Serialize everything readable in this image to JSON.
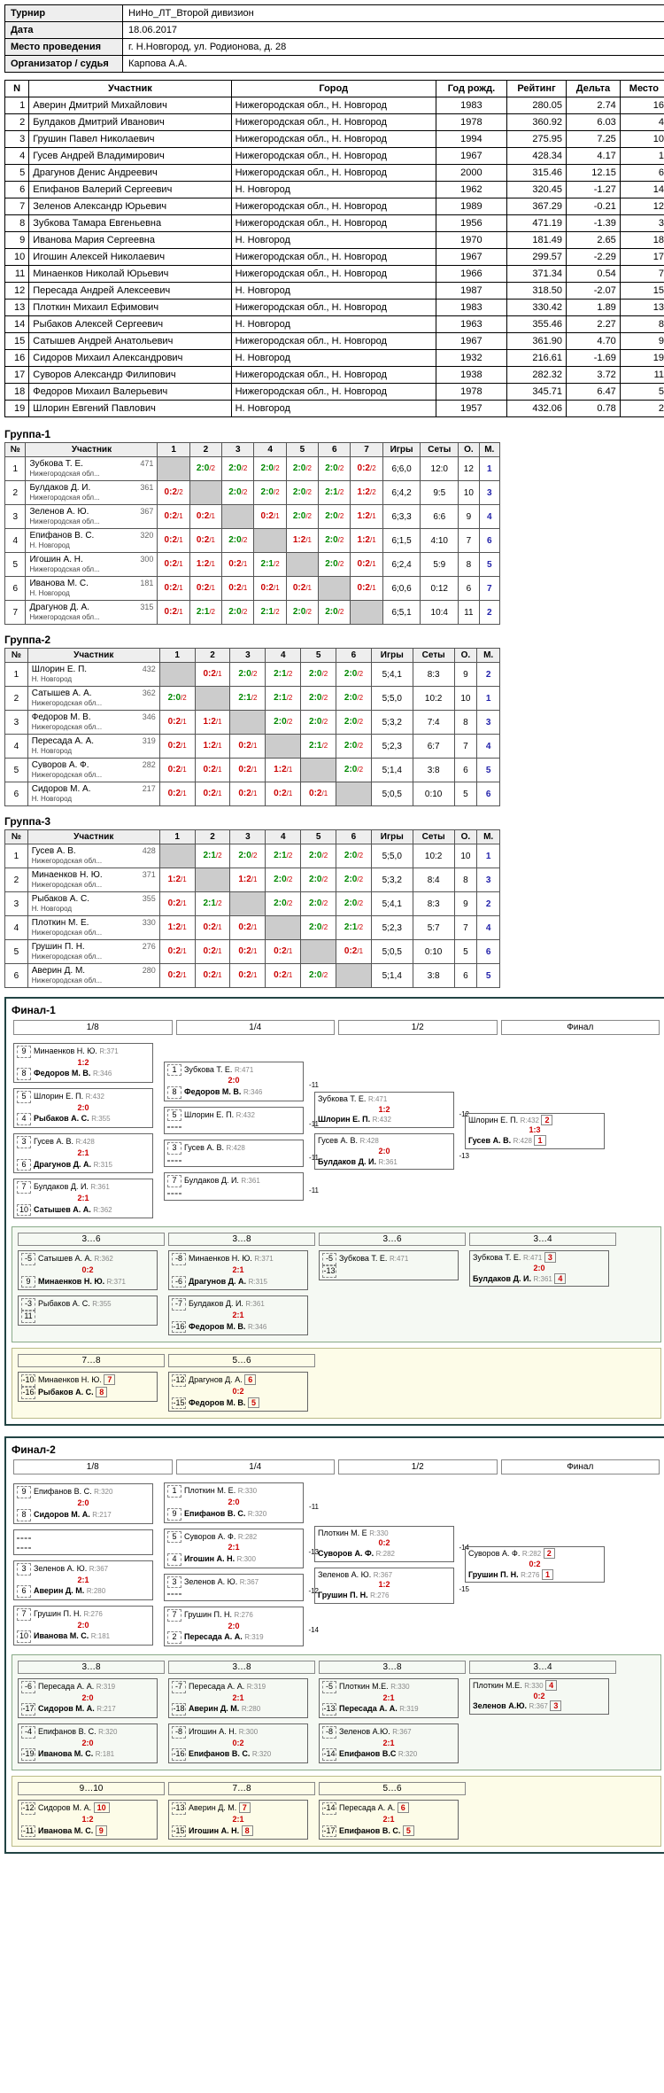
{
  "info": {
    "tournament_lbl": "Турнир",
    "tournament": "НиНо_ЛТ_Второй дивизион",
    "date_lbl": "Дата",
    "date": "18.06.2017",
    "venue_lbl": "Место проведения",
    "venue": "г. Н.Новгород, ул. Родионова, д. 28",
    "org_lbl": "Организатор / судья",
    "org": "Карпова А.А."
  },
  "headers": {
    "n": "N",
    "participant": "Участник",
    "city": "Город",
    "year": "Год рожд.",
    "rating": "Рейтинг",
    "delta": "Дельта",
    "place": "Место"
  },
  "players": [
    {
      "n": 1,
      "name": "Аверин Дмитрий Михайлович",
      "city": "Нижегородская обл., Н. Новгород",
      "year": 1983,
      "rating": "280.05",
      "delta": "2.74",
      "place": 16
    },
    {
      "n": 2,
      "name": "Булдаков Дмитрий Иванович",
      "city": "Нижегородская обл., Н. Новгород",
      "year": 1978,
      "rating": "360.92",
      "delta": "6.03",
      "place": 4
    },
    {
      "n": 3,
      "name": "Грушин Павел Николаевич",
      "city": "Нижегородская обл., Н. Новгород",
      "year": 1994,
      "rating": "275.95",
      "delta": "7.25",
      "place": 10
    },
    {
      "n": 4,
      "name": "Гусев Андрей Владимирович",
      "city": "Нижегородская обл., Н. Новгород",
      "year": 1967,
      "rating": "428.34",
      "delta": "4.17",
      "place": 1
    },
    {
      "n": 5,
      "name": "Драгунов Денис Андреевич",
      "city": "Нижегородская обл., Н. Новгород",
      "year": 2000,
      "rating": "315.46",
      "delta": "12.15",
      "place": 6
    },
    {
      "n": 6,
      "name": "Епифанов Валерий Сергеевич",
      "city": "Н. Новгород",
      "year": 1962,
      "rating": "320.45",
      "delta": "-1.27",
      "place": 14
    },
    {
      "n": 7,
      "name": "Зеленов Александр Юрьевич",
      "city": "Нижегородская обл., Н. Новгород",
      "year": 1989,
      "rating": "367.29",
      "delta": "-0.21",
      "place": 12
    },
    {
      "n": 8,
      "name": "Зубкова Тамара Евгеньевна",
      "city": "Нижегородская обл., Н. Новгород",
      "year": 1956,
      "rating": "471.19",
      "delta": "-1.39",
      "place": 3
    },
    {
      "n": 9,
      "name": "Иванова Мария Сергеевна",
      "city": "Н. Новгород",
      "year": 1970,
      "rating": "181.49",
      "delta": "2.65",
      "place": 18
    },
    {
      "n": 10,
      "name": "Игошин Алексей Николаевич",
      "city": "Нижегородская обл., Н. Новгород",
      "year": 1967,
      "rating": "299.57",
      "delta": "-2.29",
      "place": 17
    },
    {
      "n": 11,
      "name": "Минаенков Николай Юрьевич",
      "city": "Нижегородская обл., Н. Новгород",
      "year": 1966,
      "rating": "371.34",
      "delta": "0.54",
      "place": 7
    },
    {
      "n": 12,
      "name": "Пересада Андрей Алексеевич",
      "city": "Н. Новгород",
      "year": 1987,
      "rating": "318.50",
      "delta": "-2.07",
      "place": 15
    },
    {
      "n": 13,
      "name": "Плоткин Михаил Ефимович",
      "city": "Нижегородская обл., Н. Новгород",
      "year": 1983,
      "rating": "330.42",
      "delta": "1.89",
      "place": 13
    },
    {
      "n": 14,
      "name": "Рыбаков Алексей Сергеевич",
      "city": "Н. Новгород",
      "year": 1963,
      "rating": "355.46",
      "delta": "2.27",
      "place": 8
    },
    {
      "n": 15,
      "name": "Сатышев Андрей Анатольевич",
      "city": "Нижегородская обл., Н. Новгород",
      "year": 1967,
      "rating": "361.90",
      "delta": "4.70",
      "place": 9
    },
    {
      "n": 16,
      "name": "Сидоров Михаил Александрович",
      "city": "Н. Новгород",
      "year": 1932,
      "rating": "216.61",
      "delta": "-1.69",
      "place": 19
    },
    {
      "n": 17,
      "name": "Суворов Александр Филипович",
      "city": "Нижегородская обл., Н. Новгород",
      "year": 1938,
      "rating": "282.32",
      "delta": "3.72",
      "place": 11
    },
    {
      "n": 18,
      "name": "Федоров Михаил Валерьевич",
      "city": "Нижегородская обл., Н. Новгород",
      "year": 1978,
      "rating": "345.71",
      "delta": "6.47",
      "place": 5
    },
    {
      "n": 19,
      "name": "Шлорин Евгений Павлович",
      "city": "Н. Новгород",
      "year": 1957,
      "rating": "432.06",
      "delta": "0.78",
      "place": 2
    }
  ],
  "group_labels": {
    "g1": "Группа-1",
    "g2": "Группа-2",
    "g3": "Группа-3"
  },
  "group_headers": {
    "num": "№",
    "participant": "Участник",
    "games": "Игры",
    "sets": "Сеты",
    "o": "О.",
    "m": "М."
  },
  "group1": {
    "players": [
      {
        "n": 1,
        "nm": "Зубкова Т. Е.",
        "ct": "Нижегородская обл...",
        "rt": "471"
      },
      {
        "n": 2,
        "nm": "Булдаков Д. И.",
        "ct": "Нижегородская обл...",
        "rt": "361"
      },
      {
        "n": 3,
        "nm": "Зеленов А. Ю.",
        "ct": "Нижегородская обл...",
        "rt": "367"
      },
      {
        "n": 4,
        "nm": "Епифанов В. С.",
        "ct": "Н. Новгород",
        "rt": "320"
      },
      {
        "n": 5,
        "nm": "Игошин А. Н.",
        "ct": "Нижегородская обл...",
        "rt": "300"
      },
      {
        "n": 6,
        "nm": "Иванова М. С.",
        "ct": "Н. Новгород",
        "rt": "181"
      },
      {
        "n": 7,
        "nm": "Драгунов Д. А.",
        "ct": "Нижегородская обл...",
        "rt": "315"
      }
    ],
    "cells": [
      [
        "",
        "2:0/2",
        "2:0/2",
        "2:0/2",
        "2:0/2",
        "2:0/2",
        "0:2/2",
        "6;6,0",
        "12:0",
        "12",
        "1"
      ],
      [
        "0:2/2",
        "",
        "2:0/2",
        "2:0/2",
        "2:0/2",
        "2:1/2",
        "1:2/2",
        "6;4,2",
        "9:5",
        "10",
        "3"
      ],
      [
        "0:2/1",
        "0:2/1",
        "",
        "0:2/1",
        "2:0/2",
        "2:0/2",
        "1:2/1",
        "6;3,3",
        "6:6",
        "9",
        "4"
      ],
      [
        "0:2/1",
        "0:2/1",
        "2:0/2",
        "",
        "1:2/1",
        "2:0/2",
        "1:2/1",
        "6;1,5",
        "4:10",
        "7",
        "6"
      ],
      [
        "0:2/1",
        "1:2/1",
        "0:2/1",
        "2:1/2",
        "",
        "2:0/2",
        "0:2/1",
        "6;2,4",
        "5:9",
        "8",
        "5"
      ],
      [
        "0:2/1",
        "0:2/1",
        "0:2/1",
        "0:2/1",
        "0:2/1",
        "",
        "0:2/1",
        "6;0,6",
        "0:12",
        "6",
        "7"
      ],
      [
        "0:2/1",
        "2:1/2",
        "2:0/2",
        "2:1/2",
        "2:0/2",
        "2:0/2",
        "",
        "6;5,1",
        "10:4",
        "11",
        "2"
      ]
    ]
  },
  "group2": {
    "players": [
      {
        "n": 1,
        "nm": "Шлорин Е. П.",
        "ct": "Н. Новгород",
        "rt": "432"
      },
      {
        "n": 2,
        "nm": "Сатышев А. А.",
        "ct": "Нижегородская обл...",
        "rt": "362"
      },
      {
        "n": 3,
        "nm": "Федоров М. В.",
        "ct": "Нижегородская обл...",
        "rt": "346"
      },
      {
        "n": 4,
        "nm": "Пересада А. А.",
        "ct": "Н. Новгород",
        "rt": "319"
      },
      {
        "n": 5,
        "nm": "Суворов А. Ф.",
        "ct": "Нижегородская обл...",
        "rt": "282"
      },
      {
        "n": 6,
        "nm": "Сидоров М. А.",
        "ct": "Н. Новгород",
        "rt": "217"
      }
    ],
    "cells": [
      [
        "",
        "0:2/1",
        "2:0/2",
        "2:1/2",
        "2:0/2",
        "2:0/2",
        "5;4,1",
        "8:3",
        "9",
        "2"
      ],
      [
        "2:0/2",
        "",
        "2:1/2",
        "2:1/2",
        "2:0/2",
        "2:0/2",
        "5;5,0",
        "10:2",
        "10",
        "1"
      ],
      [
        "0:2/1",
        "1:2/1",
        "",
        "2:0/2",
        "2:0/2",
        "2:0/2",
        "5;3,2",
        "7:4",
        "8",
        "3"
      ],
      [
        "0:2/1",
        "1:2/1",
        "0:2/1",
        "",
        "2:1/2",
        "2:0/2",
        "5;2,3",
        "6:7",
        "7",
        "4"
      ],
      [
        "0:2/1",
        "0:2/1",
        "0:2/1",
        "1:2/1",
        "",
        "2:0/2",
        "5;1,4",
        "3:8",
        "6",
        "5"
      ],
      [
        "0:2/1",
        "0:2/1",
        "0:2/1",
        "0:2/1",
        "0:2/1",
        "",
        "5;0,5",
        "0:10",
        "5",
        "6"
      ]
    ]
  },
  "group3": {
    "players": [
      {
        "n": 1,
        "nm": "Гусев А. В.",
        "ct": "Нижегородская обл...",
        "rt": "428"
      },
      {
        "n": 2,
        "nm": "Минаенков Н. Ю.",
        "ct": "Нижегородская обл...",
        "rt": "371"
      },
      {
        "n": 3,
        "nm": "Рыбаков А. С.",
        "ct": "Н. Новгород",
        "rt": "355"
      },
      {
        "n": 4,
        "nm": "Плоткин М. Е.",
        "ct": "Нижегородская обл...",
        "rt": "330"
      },
      {
        "n": 5,
        "nm": "Грушин П. Н.",
        "ct": "Нижегородская обл...",
        "rt": "276"
      },
      {
        "n": 6,
        "nm": "Аверин Д. М.",
        "ct": "Нижегородская обл...",
        "rt": "280"
      }
    ],
    "cells": [
      [
        "",
        "2:1/2",
        "2:0/2",
        "2:1/2",
        "2:0/2",
        "2:0/2",
        "5;5,0",
        "10:2",
        "10",
        "1"
      ],
      [
        "1:2/1",
        "",
        "1:2/1",
        "2:0/2",
        "2:0/2",
        "2:0/2",
        "5;3,2",
        "8:4",
        "8",
        "3"
      ],
      [
        "0:2/1",
        "2:1/2",
        "",
        "2:0/2",
        "2:0/2",
        "2:0/2",
        "5;4,1",
        "8:3",
        "9",
        "2"
      ],
      [
        "1:2/1",
        "0:2/1",
        "0:2/1",
        "",
        "2:0/2",
        "2:1/2",
        "5;2,3",
        "5:7",
        "7",
        "4"
      ],
      [
        "0:2/1",
        "0:2/1",
        "0:2/1",
        "0:2/1",
        "",
        "0:2/1",
        "5;0,5",
        "0:10",
        "5",
        "6"
      ],
      [
        "0:2/1",
        "0:2/1",
        "0:2/1",
        "0:2/1",
        "2:0/2",
        "",
        "5;1,4",
        "3:8",
        "6",
        "5"
      ]
    ]
  },
  "brackets": {
    "f1": {
      "title": "Финал-1",
      "rounds": [
        "1/8",
        "1/4",
        "1/2",
        "Финал"
      ],
      "r18": [
        {
          "s1": "9",
          "p1": "Минаенков Н. Ю.",
          "r1": "R:371",
          "sc": "1:2",
          "s2": "8",
          "p2": "Федоров М. В.",
          "r2": "R:346"
        },
        {
          "s1": "5",
          "p1": "Шлорин Е. П.",
          "r1": "R:432",
          "sc": "2:0",
          "s2": "4",
          "p2": "Рыбаков А. С.",
          "r2": "R:355"
        },
        {
          "s1": "3",
          "p1": "Гусев А. В.",
          "r1": "R:428",
          "sc": "2:1",
          "s2": "6",
          "p2": "Драгунов Д. А.",
          "r2": "R:315"
        },
        {
          "s1": "7",
          "p1": "Булдаков Д. И.",
          "r1": "R:361",
          "sc": "2:1",
          "s2": "10",
          "p2": "Сатышев А. А.",
          "r2": "R:362"
        }
      ],
      "r14": [
        {
          "s1": "1",
          "p1": "Зубкова Т. Е.",
          "r1": "R:471",
          "sc": "2:0",
          "s2": "8",
          "p2": "Федоров М. В.",
          "r2": "R:346",
          "pt": "-11"
        },
        {
          "s1": "5",
          "p1": "Шлорин Е. П.",
          "r1": "R:432",
          "sc": "",
          "s2": "",
          "p2": "",
          "r2": "",
          "pt": "-11"
        },
        {
          "s1": "3",
          "p1": "Гусев А. В.",
          "r1": "R:428",
          "sc": "",
          "s2": "",
          "p2": "",
          "r2": "",
          "pt": "-11"
        },
        {
          "s1": "7",
          "p1": "Булдаков Д. И.",
          "r1": "R:361",
          "sc": "",
          "s2": "",
          "p2": "",
          "r2": "",
          "pt": "-11"
        }
      ],
      "r12": [
        {
          "p1": "Зубкова Т. Е.",
          "r1": "R:471",
          "sc": "1:2",
          "p2": "Шлорин Е. П.",
          "r2": "R:432",
          "pt": "-12"
        },
        {
          "p1": "Гусев А. В.",
          "r1": "R:428",
          "sc": "2:0",
          "p2": "Булдаков Д. И.",
          "r2": "R:361",
          "pt": "-13"
        }
      ],
      "final": {
        "p1": "Шлорин Е. П.",
        "r1": "R:432",
        "sc": "1:3",
        "p2": "Гусев А. В.",
        "r2": "R:428",
        "pl1": "2",
        "pl2": "1"
      },
      "losers36": {
        "label36": "3…6",
        "label38": "3…8",
        "label34": "3…4",
        "m": [
          {
            "s1": "-5",
            "p1": "Сатышев А. А.",
            "r1": "R:362",
            "sc": "0:2",
            "p2": "Минаенков Н. Ю.",
            "r2": "R:371",
            "s2": "9"
          },
          {
            "s1": "-3",
            "p1": "Рыбаков А. С.",
            "r1": "R:355",
            "sc": "",
            "p2": "",
            "s2": "11"
          },
          {
            "s1": "-8",
            "p1": "Минаенков Н. Ю.",
            "r1": "R:371",
            "sc": "2:1",
            "p2": "Драгунов Д. А.",
            "r2": "R:315",
            "s2": "-6"
          },
          {
            "s1": "-7",
            "p1": "Булдаков Д. И.",
            "r1": "R:361",
            "sc": "2:1",
            "p2": "Федоров М. В.",
            "r2": "R:346",
            "s2": "-16"
          },
          {
            "s1": "-5",
            "p1": "Зубкова Т. Е.",
            "r1": "R:471",
            "sc": "",
            "p2": "",
            "s2": "-13"
          },
          {
            "p1": "Зубкова Т. Е.",
            "r1": "R:471",
            "sc": "2:0",
            "p2": "Булдаков Д. И.",
            "r2": "R:361",
            "pl1": "3",
            "pl2": "4"
          }
        ]
      },
      "losers78": {
        "label78": "7…8",
        "label56": "5…6",
        "m": [
          {
            "s1": "-10",
            "p1": "Минаенков Н. Ю.",
            "sc": "",
            "p2": "Рыбаков А. С.",
            "s2": "-16",
            "pl1": "7",
            "pl2": "8"
          },
          {
            "s1": "-12",
            "p1": "Драгунов Д. А.",
            "sc": "0:2",
            "p2": "Федоров М. В.",
            "s2": "-15",
            "pl1": "6",
            "pl2": "5"
          }
        ]
      }
    },
    "f2": {
      "title": "Финал-2",
      "rounds": [
        "1/8",
        "1/4",
        "1/2",
        "Финал"
      ],
      "r18": [
        {
          "s1": "9",
          "p1": "Епифанов В. С.",
          "r1": "R:320",
          "sc": "2:0",
          "s2": "8",
          "p2": "Сидоров М. А.",
          "r2": "R:217"
        },
        {
          "s1": "",
          "p1": "",
          "sc": "",
          "s2": "",
          "p2": ""
        },
        {
          "s1": "3",
          "p1": "Зеленов А. Ю.",
          "r1": "R:367",
          "sc": "2:1",
          "s2": "6",
          "p2": "Аверин Д. М.",
          "r2": "R:280"
        },
        {
          "s1": "7",
          "p1": "Грушин П. Н.",
          "r1": "R:276",
          "sc": "2:0",
          "s2": "10",
          "p2": "Иванова М. С.",
          "r2": "R:181"
        }
      ],
      "r14": [
        {
          "s1": "1",
          "p1": "Плоткин М. Е.",
          "r1": "R:330",
          "sc": "2:0",
          "s2": "9",
          "p2": "Епифанов В. С.",
          "r2": "R:320",
          "pt": "-11"
        },
        {
          "s1": "5",
          "p1": "Суворов А. Ф.",
          "r1": "R:282",
          "sc": "2:1",
          "s2": "4",
          "p2": "Игошин А. Н.",
          "r2": "R:300",
          "pt": "-13"
        },
        {
          "s1": "3",
          "p1": "Зеленов А. Ю.",
          "r1": "R:367",
          "sc": "",
          "s2": "",
          "p2": "",
          "r2": "",
          "pt": "-12"
        },
        {
          "s1": "7",
          "p1": "Грушин П. Н.",
          "r1": "R:276",
          "sc": "2:0",
          "s2": "2",
          "p2": "Пересада А. А.",
          "r2": "R:319",
          "pt": "-14"
        }
      ],
      "r12": [
        {
          "p1": "Плоткин М. Е",
          "r1": "R:330",
          "sc": "0:2",
          "p2": "Суворов А. Ф.",
          "r2": "R:282",
          "pt": "-14"
        },
        {
          "p1": "Зеленов А. Ю.",
          "r1": "R:367",
          "sc": "1:2",
          "p2": "Грушин П. Н.",
          "r2": "R:276",
          "pt": "-15"
        }
      ],
      "final": {
        "p1": "Суворов А. Ф.",
        "r1": "R:282",
        "sc": "0:2",
        "p2": "Грушин П. Н.",
        "r2": "R:276",
        "pl1": "2",
        "pl2": "1"
      },
      "losers38": {
        "label38": "3…8",
        "label34": "3…4",
        "m": [
          {
            "s1": "-6",
            "p1": "Пересада А. А.",
            "r1": "R:319",
            "sc": "2:0",
            "p2": "Сидоров М. А.",
            "r2": "R:217",
            "s2": "-17"
          },
          {
            "s1": "-4",
            "p1": "Епифанов В. С.",
            "r1": "R:320",
            "sc": "2:0",
            "p2": "Иванова М. С.",
            "r2": "R:181",
            "s2": "-19"
          },
          {
            "s1": "-7",
            "p1": "Пересада А. А.",
            "r1": "R:319",
            "sc": "2:1",
            "p2": "Аверин Д. М.",
            "r2": "R:280",
            "s2": "-18"
          },
          {
            "s1": "-8",
            "p1": "Игошин А. Н.",
            "r1": "R:300",
            "sc": "0:2",
            "p2": "Епифанов В. С.",
            "r2": "R:320",
            "s2": "-16"
          },
          {
            "s1": "-5",
            "p1": "Плоткин М.Е.",
            "r1": "R:330",
            "sc": "2:1",
            "p2": "Пересада А. А.",
            "r2": "R:319",
            "s2": "-13"
          },
          {
            "s1": "-8",
            "p1": "Зеленов А.Ю.",
            "r1": "R:367",
            "sc": "2:1",
            "p2": "Епифанов В.С",
            "r2": "R:320",
            "s2": "-14"
          },
          {
            "p1": "Плоткин М.Е.",
            "r1": "R:330",
            "sc": "0:2",
            "p2": "Зеленов А.Ю.",
            "r2": "R:367",
            "pl1": "4",
            "pl2": "3"
          }
        ]
      },
      "losers910": {
        "label910": "9…10",
        "label78": "7…8",
        "label56": "5…6",
        "m": [
          {
            "s1": "-12",
            "p1": "Сидоров М. А.",
            "sc": "1:2",
            "p2": "Иванова М. С.",
            "s2": "-11",
            "pl1": "10",
            "pl2": "9"
          },
          {
            "s1": "-13",
            "p1": "Аверин Д. М.",
            "sc": "2:1",
            "p2": "Игошин А. Н.",
            "s2": "-15",
            "pl1": "7",
            "pl2": "8"
          },
          {
            "s1": "-14",
            "p1": "Пересада А. А.",
            "sc": "2:1",
            "p2": "Епифанов В. С.",
            "s2": "-17",
            "pl1": "6",
            "pl2": "5"
          }
        ]
      }
    }
  }
}
